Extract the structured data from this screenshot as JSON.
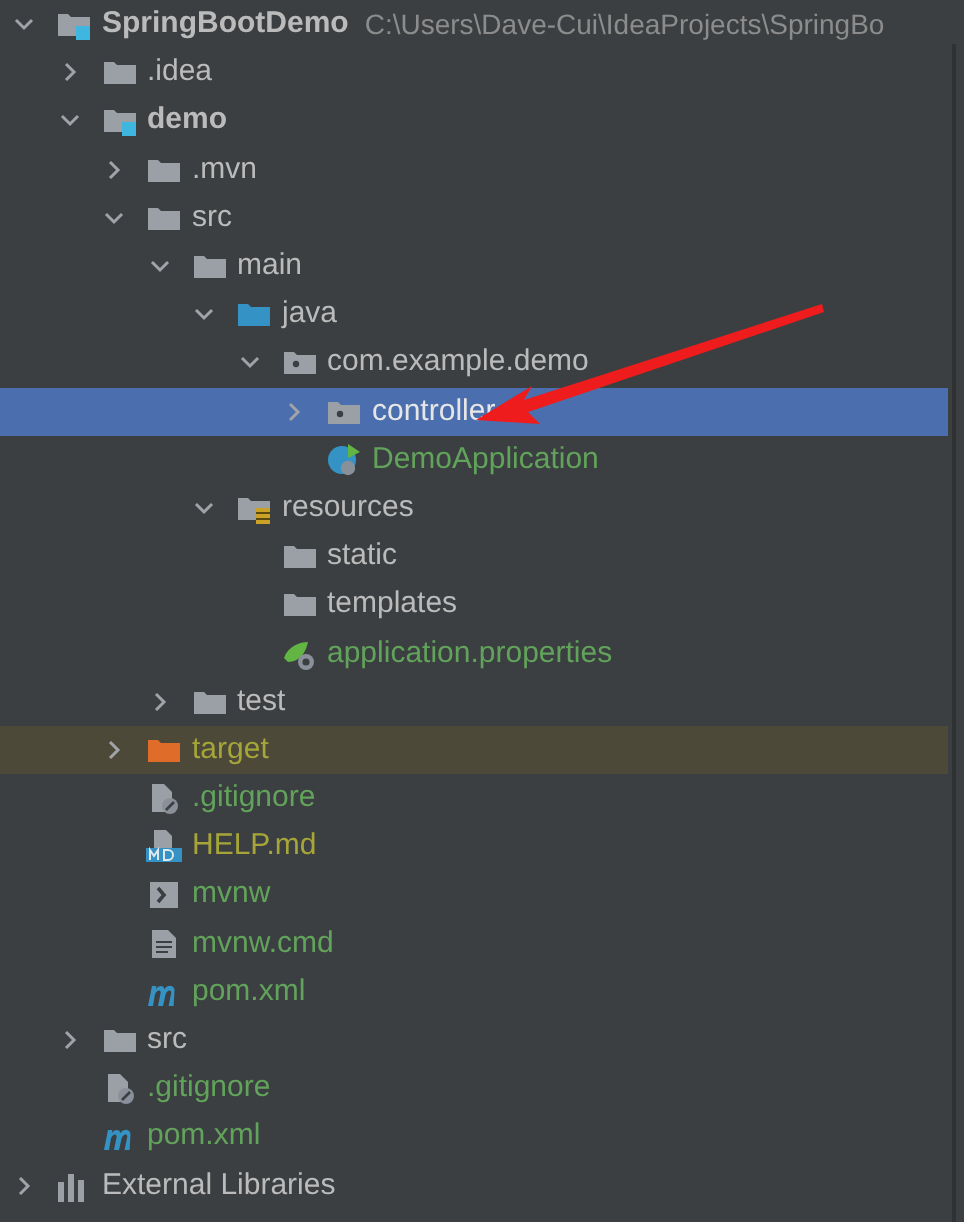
{
  "tree": [
    {
      "name": "SpringBootDemo",
      "kind": "module",
      "bold": true,
      "path": "C:\\Users\\Dave-Cui\\IdeaProjects\\SpringBo",
      "expanded": true,
      "selected": false,
      "children": [
        {
          "name": ".idea",
          "kind": "folder",
          "expanded": false,
          "selected": false
        },
        {
          "name": "demo",
          "kind": "module",
          "bold": true,
          "expanded": true,
          "selected": false,
          "children": [
            {
              "name": ".mvn",
              "kind": "folder",
              "expanded": false,
              "selected": false
            },
            {
              "name": "src",
              "kind": "folder",
              "expanded": true,
              "selected": false,
              "children": [
                {
                  "name": "main",
                  "kind": "folder",
                  "expanded": true,
                  "selected": false,
                  "children": [
                    {
                      "name": "java",
                      "kind": "sources",
                      "expanded": true,
                      "selected": false,
                      "children": [
                        {
                          "name": "com.example.demo",
                          "kind": "package",
                          "expanded": true,
                          "selected": false,
                          "children": [
                            {
                              "name": "controller",
                              "kind": "package",
                              "expanded": false,
                              "selected": true
                            },
                            {
                              "name": "DemoApplication",
                              "kind": "springclass",
                              "color": "#62a35b",
                              "selected": false
                            }
                          ]
                        }
                      ]
                    },
                    {
                      "name": "resources",
                      "kind": "resources",
                      "expanded": true,
                      "selected": false,
                      "children": [
                        {
                          "name": "static",
                          "kind": "folder",
                          "selected": false
                        },
                        {
                          "name": "templates",
                          "kind": "folder",
                          "selected": false
                        },
                        {
                          "name": "application.properties",
                          "kind": "properties",
                          "color": "#62a35b",
                          "selected": false
                        }
                      ]
                    }
                  ]
                },
                {
                  "name": "test",
                  "kind": "folder",
                  "expanded": false,
                  "selected": false
                }
              ]
            },
            {
              "name": "target",
              "kind": "excluded",
              "color": "#a5a53a",
              "highlighted": true,
              "expanded": false,
              "selected": false
            },
            {
              "name": ".gitignore",
              "kind": "gitignore",
              "color": "#62a35b",
              "selected": false
            },
            {
              "name": "HELP.md",
              "kind": "markdown",
              "color": "#a5a53a",
              "selected": false
            },
            {
              "name": "mvnw",
              "kind": "shell",
              "color": "#62a35b",
              "selected": false
            },
            {
              "name": "mvnw.cmd",
              "kind": "text",
              "color": "#62a35b",
              "selected": false
            },
            {
              "name": "pom.xml",
              "kind": "maven",
              "color": "#62a35b",
              "selected": false
            }
          ]
        },
        {
          "name": "src",
          "kind": "folder",
          "expanded": false,
          "selected": false
        },
        {
          "name": ".gitignore",
          "kind": "gitignore",
          "color": "#62a35b",
          "selected": false
        },
        {
          "name": "pom.xml",
          "kind": "maven",
          "color": "#62a35b",
          "selected": false
        }
      ]
    },
    {
      "name": "External Libraries",
      "kind": "libraries",
      "expanded": false,
      "selected": false
    }
  ]
}
